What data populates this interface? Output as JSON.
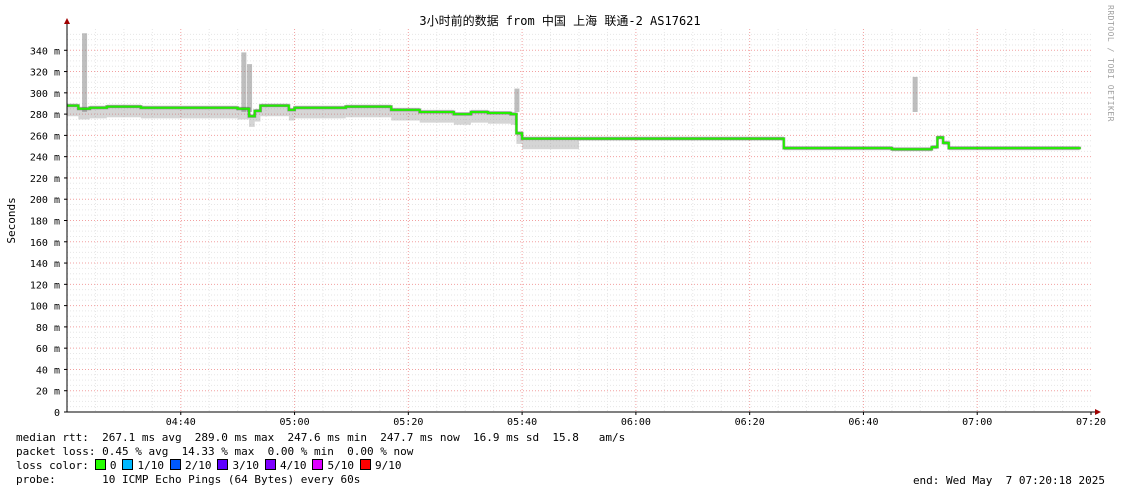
{
  "chart_data": {
    "type": "line",
    "title": "3小时前的数据 from 中国 上海 联通-2 AS17621",
    "ylabel": "Seconds",
    "xlabel": "",
    "ylim": [
      0,
      360
    ],
    "y_ticks": [
      {
        "v": 0,
        "label": "0"
      },
      {
        "v": 20,
        "label": "20 m"
      },
      {
        "v": 40,
        "label": "40 m"
      },
      {
        "v": 60,
        "label": "60 m"
      },
      {
        "v": 80,
        "label": "80 m"
      },
      {
        "v": 100,
        "label": "100 m"
      },
      {
        "v": 120,
        "label": "120 m"
      },
      {
        "v": 140,
        "label": "140 m"
      },
      {
        "v": 160,
        "label": "160 m"
      },
      {
        "v": 180,
        "label": "180 m"
      },
      {
        "v": 200,
        "label": "200 m"
      },
      {
        "v": 220,
        "label": "220 m"
      },
      {
        "v": 240,
        "label": "240 m"
      },
      {
        "v": 260,
        "label": "260 m"
      },
      {
        "v": 280,
        "label": "280 m"
      },
      {
        "v": 300,
        "label": "300 m"
      },
      {
        "v": 320,
        "label": "320 m"
      },
      {
        "v": 340,
        "label": "340 m"
      }
    ],
    "x_ticks": [
      "04:40",
      "05:00",
      "05:20",
      "05:40",
      "06:00",
      "06:20",
      "06:40",
      "07:00",
      "07:20"
    ],
    "x_start": "04:20",
    "x_end": "07:20",
    "grid": true,
    "series": [
      {
        "name": "median rtt",
        "color": "#22ee00",
        "points": [
          [
            "04:20",
            288
          ],
          [
            "04:22",
            285
          ],
          [
            "04:24",
            286
          ],
          [
            "04:27",
            287
          ],
          [
            "04:30",
            287
          ],
          [
            "04:33",
            286
          ],
          [
            "04:36",
            286
          ],
          [
            "04:39",
            286
          ],
          [
            "04:42",
            286
          ],
          [
            "04:45",
            286
          ],
          [
            "04:48",
            286
          ],
          [
            "04:50",
            285
          ],
          [
            "04:52",
            278
          ],
          [
            "04:53",
            283
          ],
          [
            "04:54",
            288
          ],
          [
            "04:57",
            288
          ],
          [
            "04:59",
            284
          ],
          [
            "05:00",
            286
          ],
          [
            "05:03",
            286
          ],
          [
            "05:06",
            286
          ],
          [
            "05:09",
            287
          ],
          [
            "05:12",
            287
          ],
          [
            "05:15",
            287
          ],
          [
            "05:17",
            284
          ],
          [
            "05:19",
            284
          ],
          [
            "05:22",
            282
          ],
          [
            "05:25",
            282
          ],
          [
            "05:28",
            280
          ],
          [
            "05:31",
            282
          ],
          [
            "05:34",
            281
          ],
          [
            "05:37",
            281
          ],
          [
            "05:38",
            280
          ],
          [
            "05:39",
            262
          ],
          [
            "05:40",
            257
          ],
          [
            "05:50",
            257
          ],
          [
            "06:00",
            257
          ],
          [
            "06:10",
            257
          ],
          [
            "06:20",
            257
          ],
          [
            "06:25",
            257
          ],
          [
            "06:26",
            248
          ],
          [
            "06:35",
            248
          ],
          [
            "06:45",
            247
          ],
          [
            "06:50",
            247
          ],
          [
            "06:52",
            249
          ],
          [
            "06:53",
            258
          ],
          [
            "06:54",
            253
          ],
          [
            "06:55",
            248
          ],
          [
            "07:00",
            248
          ],
          [
            "07:10",
            248
          ],
          [
            "07:18",
            247
          ]
        ]
      }
    ],
    "smoke_spikes": [
      [
        "04:23",
        356
      ],
      [
        "04:51",
        338
      ],
      [
        "04:52",
        327
      ],
      [
        "05:39",
        304
      ],
      [
        "06:49",
        315
      ],
      [
        "06:53",
        272
      ]
    ]
  },
  "colors": {
    "line": "#22ee00",
    "smoke": "#888888",
    "grid_major": "#f2a0a0",
    "grid_minor": "#e6e6e6",
    "axis": "#000000",
    "arrow": "#a00000"
  },
  "legend": {
    "median_rtt": "median rtt:  267.1 ms avg  289.0 ms max  247.6 ms min  247.7 ms now  16.9 ms sd  15.8   am/s",
    "packet_loss": "packet loss: 0.45 % avg  14.33 % max  0.00 % min  0.00 % now",
    "loss_color_label": "loss color:",
    "loss_items": [
      {
        "label": "0",
        "color": "#26ff00"
      },
      {
        "label": "1/10",
        "color": "#00b8ff"
      },
      {
        "label": "2/10",
        "color": "#0059ff"
      },
      {
        "label": "3/10",
        "color": "#5e00ff"
      },
      {
        "label": "4/10",
        "color": "#7e00ff"
      },
      {
        "label": "5/10",
        "color": "#dd00ff"
      },
      {
        "label": "9/10",
        "color": "#ff0000"
      }
    ],
    "probe": "probe:       10 ICMP Echo Pings (64 Bytes) every 60s",
    "end": "end: Wed May  7 07:20:18 2025"
  },
  "watermark": "RRDTOOL / TOBI OETIKER"
}
